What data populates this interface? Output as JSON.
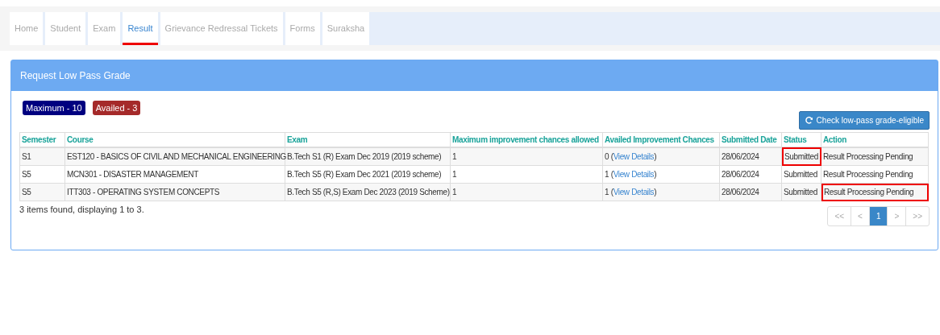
{
  "tabs": [
    {
      "label": "Home",
      "selected": false
    },
    {
      "label": "Student",
      "selected": false
    },
    {
      "label": "Exam",
      "selected": false
    },
    {
      "label": "Result",
      "selected": true
    },
    {
      "label": "Grievance Redressal Tickets",
      "selected": false
    },
    {
      "label": "Forms",
      "selected": false
    },
    {
      "label": "Suraksha",
      "selected": false
    }
  ],
  "panel": {
    "title": "Request Low Pass Grade",
    "badges": [
      {
        "text": "Maximum - 10",
        "color": "#000080"
      },
      {
        "text": "Availed - 3",
        "color": "#a52a2a"
      }
    ],
    "check_button": "Check low-pass grade-eligible",
    "table": {
      "columns": [
        "Semester",
        "Course",
        "Exam",
        "Maximum improvement chances allowed",
        "Availed Improvement Chances",
        "Submitted Date",
        "Status",
        "Action"
      ],
      "rows": [
        {
          "semester": "S1",
          "course": "EST120 - BASICS OF CIVIL AND MECHANICAL ENGINEERING",
          "exam": "B.Tech S1 (R) Exam Dec 2019 (2019 scheme)",
          "max_chances": "1",
          "availed": {
            "before": "0 (",
            "link": "View Details",
            "after": ")"
          },
          "date": "28/06/2024",
          "status": "Submitted",
          "status_highlighted": true,
          "action": "Result Processing Pending",
          "action_highlighted": false
        },
        {
          "semester": "S5",
          "course": "MCN301 - DISASTER MANAGEMENT",
          "exam": "B.Tech S5 (R) Exam Dec 2021 (2019 scheme)",
          "max_chances": "1",
          "availed": {
            "before": "1 (",
            "link": "View Details",
            "after": ")"
          },
          "date": "28/06/2024",
          "status": "Submitted",
          "status_highlighted": false,
          "action": "Result Processing Pending",
          "action_highlighted": false
        },
        {
          "semester": "S5",
          "course": "ITT303 - OPERATING SYSTEM CONCEPTS",
          "exam": "B.Tech S5 (R,S) Exam Dec 2023 (2019 Scheme)",
          "max_chances": "1",
          "availed": {
            "before": "1 (",
            "link": "View Details",
            "after": ")"
          },
          "date": "28/06/2024",
          "status": "Submitted",
          "status_highlighted": false,
          "action": "Result Processing Pending",
          "action_highlighted": true
        }
      ]
    },
    "summary": "3 items found, displaying 1 to 3.",
    "pagination": [
      {
        "label": "<<",
        "selected": false
      },
      {
        "label": "<",
        "selected": false
      },
      {
        "label": "1",
        "selected": true
      },
      {
        "label": ">",
        "selected": false
      },
      {
        "label": ">>",
        "selected": false
      }
    ]
  }
}
